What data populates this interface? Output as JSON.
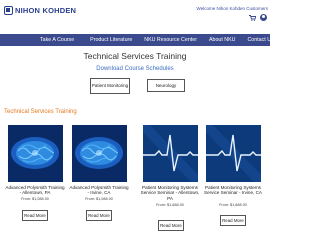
{
  "header": {
    "logo_text": "NIHON KOHDEN",
    "welcome": "Welcome Nihon Kohden Customers",
    "cart_icon": "cart-icon",
    "user_icon": "user-icon"
  },
  "nav": {
    "items": [
      "Take A Course",
      "Product Literature",
      "NKU Resource Center",
      "About NKU",
      "Contact Us"
    ]
  },
  "main": {
    "title": "Technical Services Training",
    "subtitle": "Download Course Schedules",
    "buttons": {
      "patient_monitoring": "Patient Monitoring",
      "neurology": "Neurology"
    },
    "section_label": "Technical Services Training"
  },
  "courses": [
    {
      "title": "Advanced Polysmith Training - Allentown, PA",
      "price": "From: $1,088.00",
      "button": "Read More",
      "image": "brain-scan"
    },
    {
      "title": "Advanced Polysmith Training - Irvine, CA",
      "price": "From: $1,088.00",
      "button": "Read More",
      "image": "brain-scan"
    },
    {
      "title": "Patient Monitoring Systems Service Seminar - Allentown, PA",
      "price": "From: $1,688.00",
      "button": "Read More",
      "image": "ecg-waveform"
    },
    {
      "title": "Patient Monitoring Systems Service Seminar - Irvine, CA",
      "price": "From: $1,688.00",
      "button": "Read More",
      "image": "ecg-waveform"
    }
  ],
  "colors": {
    "nav_bg": "#3a4a8c",
    "accent_orange": "#e57a1e",
    "link_blue": "#3b6fc2"
  }
}
